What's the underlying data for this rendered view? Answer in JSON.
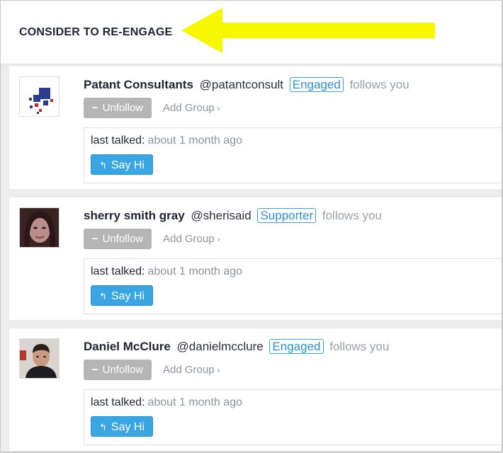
{
  "header": {
    "title": "CONSIDER TO RE-ENGAGE"
  },
  "colors": {
    "accent": "#39a6e3",
    "annotation_arrow": "#f7f700",
    "unfollow": "#b5b5b5"
  },
  "icons": {
    "unfollow": "minus-icon",
    "add_group": "chevron-right-icon",
    "say_hi": "reply-arrow-icon"
  },
  "users": [
    {
      "name": "Patant Consultants",
      "handle": "@patantconsult",
      "badge": "Engaged",
      "follows": "follows you",
      "unfollow_label": "Unfollow",
      "add_group_label": "Add Group",
      "last_talked_label": "last talked:",
      "last_talked_value": "about 1 month ago",
      "say_hi_label": "Say Hi"
    },
    {
      "name": "sherry smith gray",
      "handle": "@sherisaid",
      "badge": "Supporter",
      "follows": "follows you",
      "unfollow_label": "Unfollow",
      "add_group_label": "Add Group",
      "last_talked_label": "last talked:",
      "last_talked_value": "about 1 month ago",
      "say_hi_label": "Say Hi"
    },
    {
      "name": "Daniel McClure",
      "handle": "@danielmcclure",
      "badge": "Engaged",
      "follows": "follows you",
      "unfollow_label": "Unfollow",
      "add_group_label": "Add Group",
      "last_talked_label": "last talked:",
      "last_talked_value": "about 1 month ago",
      "say_hi_label": "Say Hi"
    }
  ]
}
